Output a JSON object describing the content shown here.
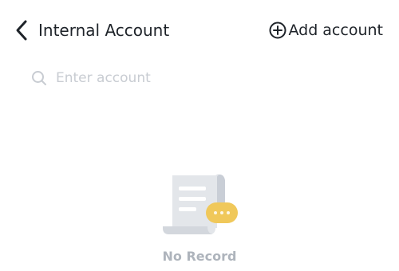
{
  "header": {
    "title": "Internal Account",
    "back_icon": "chevron-left-icon",
    "add_account_icon": "plus-circle-icon",
    "add_account_label": "Add account"
  },
  "search": {
    "icon": "search-icon",
    "placeholder": "Enter account",
    "value": ""
  },
  "empty_state": {
    "icon": "receipt-document-icon",
    "message": "No Record"
  },
  "colors": {
    "text_primary": "#1e2329",
    "placeholder": "#c8ccd2",
    "empty_text": "#aeb4bc",
    "accent_gold": "#f0c85a"
  }
}
